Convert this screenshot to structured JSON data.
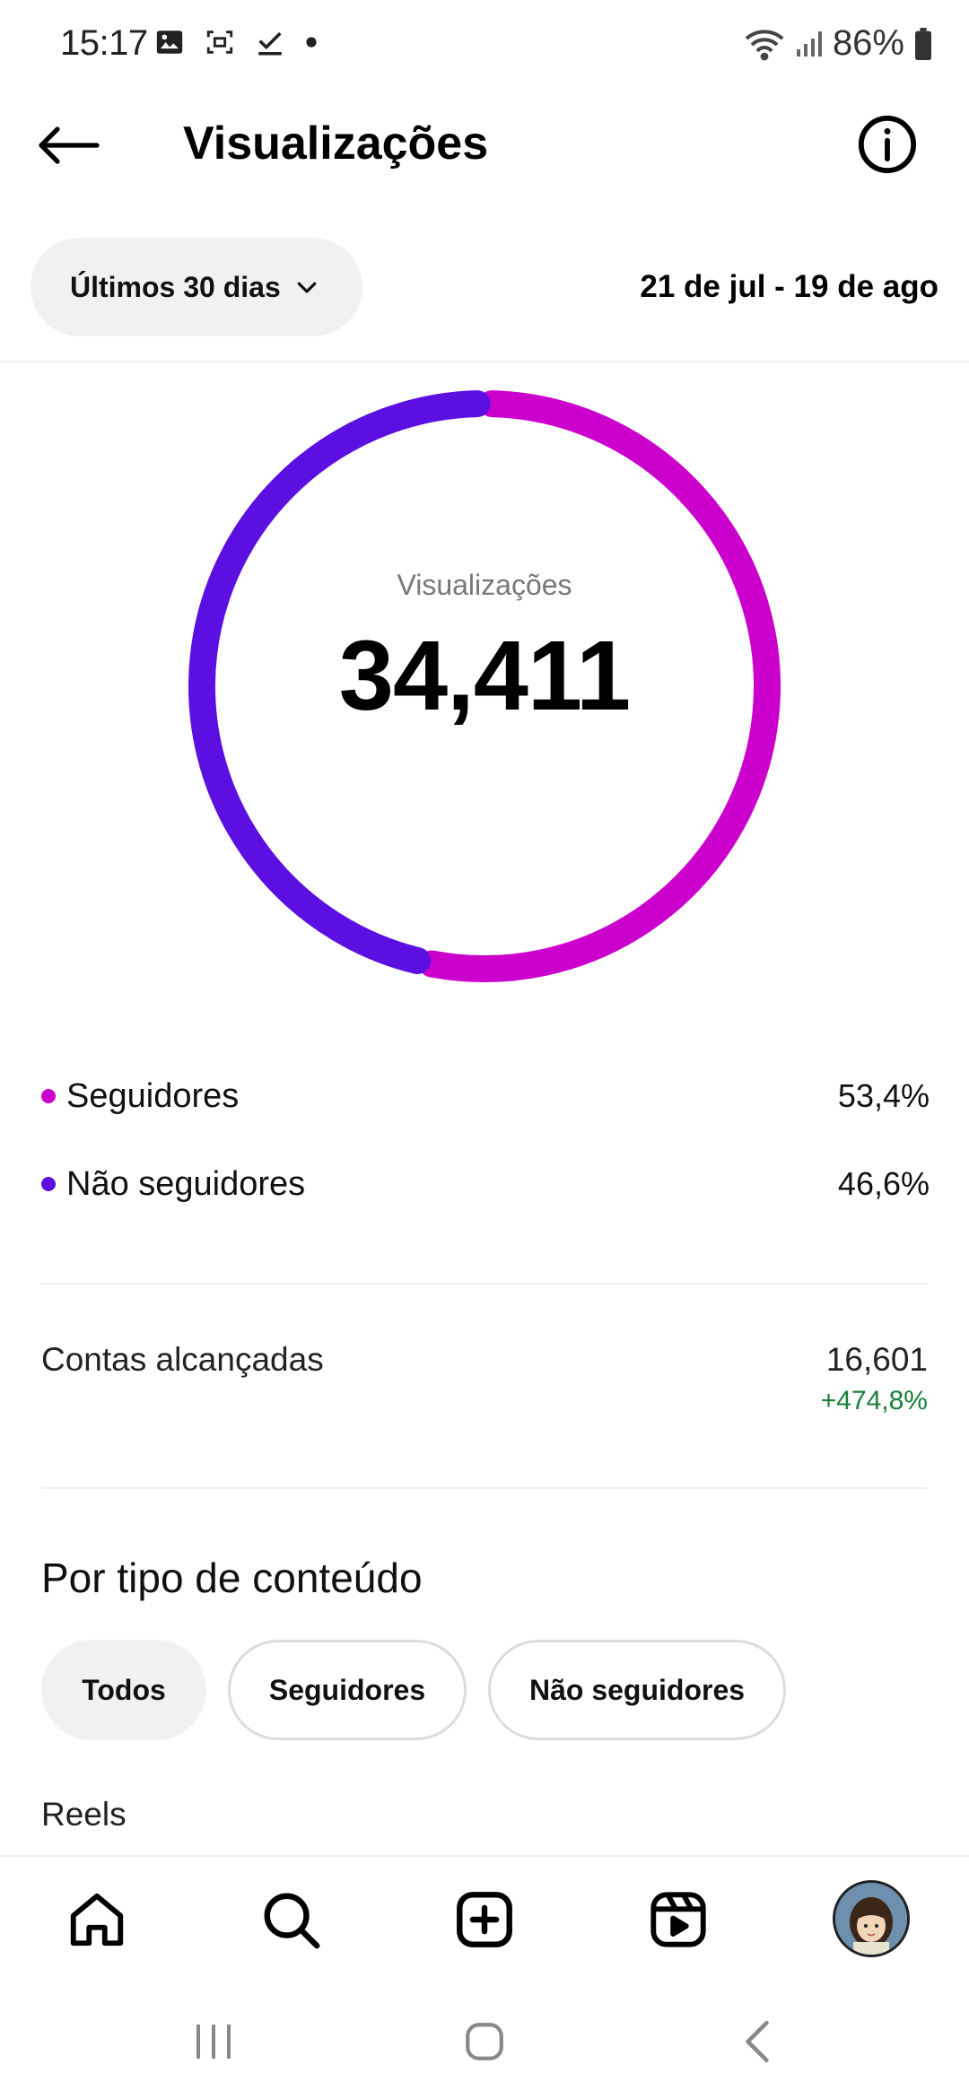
{
  "status_bar": {
    "time": "15:17",
    "battery": "86%",
    "icons_left": [
      "gallery-icon",
      "screenshot-icon",
      "check-icon",
      "dot-icon"
    ],
    "icons_right": [
      "wifi-icon",
      "signal-icon",
      "battery-icon"
    ]
  },
  "header": {
    "title": "Visualizações",
    "back_icon": "arrow-left-icon",
    "info_icon": "info-icon"
  },
  "filter": {
    "range_label": "Últimos 30 dias",
    "date_range": "21 de jul - 19 de ago"
  },
  "colors": {
    "followers": "#cc00cc",
    "non_followers": "#5b0fe0",
    "positive": "#188038"
  },
  "summary": {
    "label": "Visualizações",
    "value": "34,411"
  },
  "chart_data": {
    "type": "pie",
    "categories": [
      "Seguidores",
      "Não seguidores"
    ],
    "values": [
      53.4,
      46.6
    ],
    "title": "Visualizações",
    "center_value": "34,411"
  },
  "legend": [
    {
      "label": "Seguidores",
      "value": "53,4%"
    },
    {
      "label": "Não seguidores",
      "value": "46,6%"
    }
  ],
  "reach": {
    "label": "Contas alcançadas",
    "value": "16,601",
    "change": "+474,8%"
  },
  "content_type": {
    "title": "Por tipo de conteúdo",
    "chips": [
      {
        "label": "Todos",
        "active": true
      },
      {
        "label": "Seguidores",
        "active": false
      },
      {
        "label": "Não seguidores",
        "active": false
      }
    ],
    "first_row_label": "Reels"
  },
  "bottom_nav": [
    "home-icon",
    "search-icon",
    "create-icon",
    "reels-icon",
    "profile-avatar"
  ],
  "system_nav": [
    "recents-icon",
    "home-button-icon",
    "back-icon"
  ]
}
